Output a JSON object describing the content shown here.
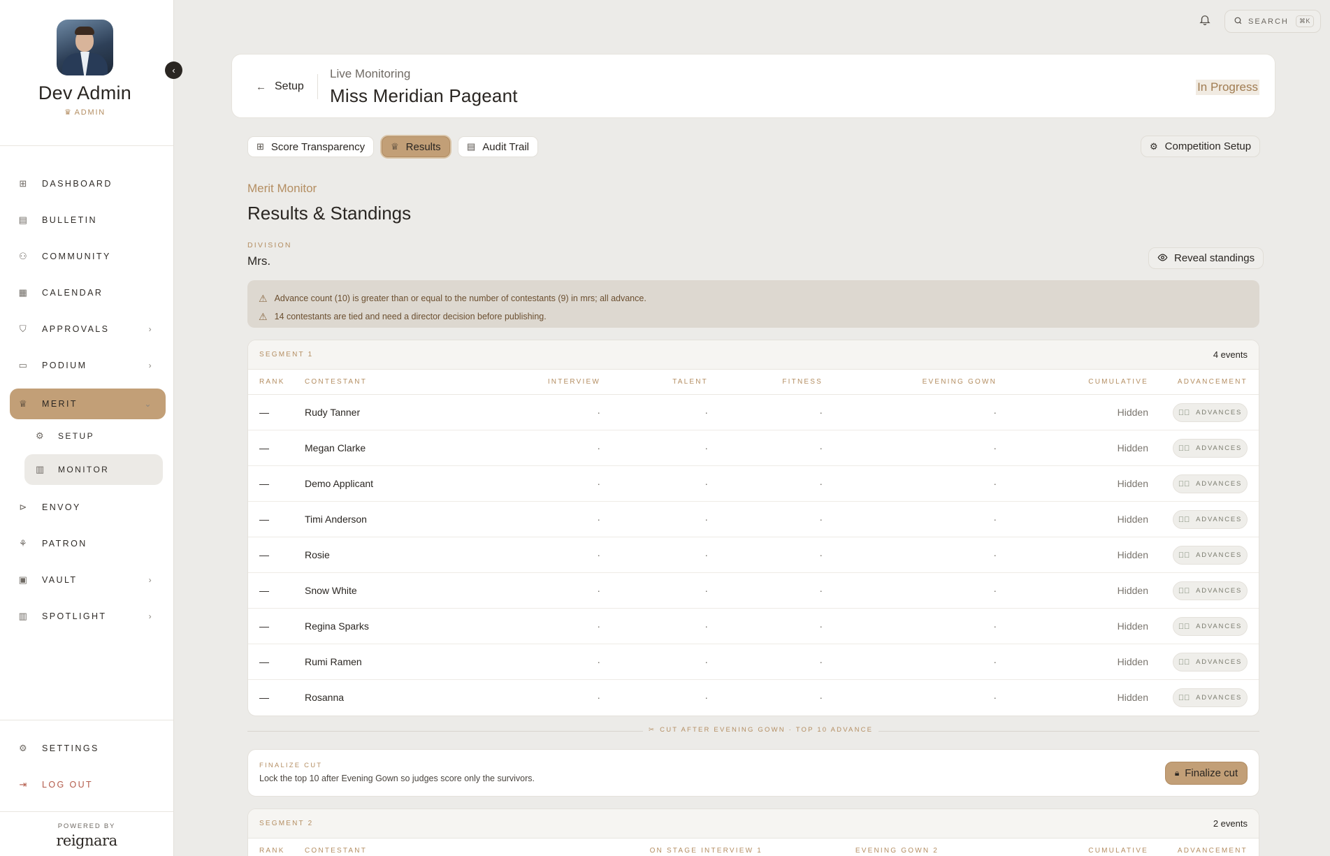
{
  "profile": {
    "name": "Dev Admin",
    "role": "ADMIN"
  },
  "nav": [
    {
      "label": "DASHBOARD",
      "icon": "grid-icon",
      "glyph": "⊞",
      "chevron": false
    },
    {
      "label": "BULLETIN",
      "icon": "newspaper-icon",
      "glyph": "▤",
      "chevron": false
    },
    {
      "label": "COMMUNITY",
      "icon": "users-icon",
      "glyph": "⚇",
      "chevron": false
    },
    {
      "label": "CALENDAR",
      "icon": "calendar-icon",
      "glyph": "▦",
      "chevron": false
    },
    {
      "label": "APPROVALS",
      "icon": "shield-check-icon",
      "glyph": "⛉",
      "chevron": true
    },
    {
      "label": "PODIUM",
      "icon": "message-square-icon",
      "glyph": "▭",
      "chevron": true
    }
  ],
  "merit": {
    "label": "MERIT",
    "sub": [
      {
        "label": "SETUP"
      },
      {
        "label": "MONITOR"
      }
    ]
  },
  "nav2": [
    {
      "label": "ENVOY",
      "icon": "send-icon",
      "glyph": "⊳",
      "chevron": false
    },
    {
      "label": "PATRON",
      "icon": "hand-coins-icon",
      "glyph": "⚘",
      "chevron": false
    },
    {
      "label": "VAULT",
      "icon": "archive-icon",
      "glyph": "▣",
      "chevron": true
    },
    {
      "label": "SPOTLIGHT",
      "icon": "bar-chart-icon",
      "glyph": "▥",
      "chevron": true
    }
  ],
  "bottom_nav": {
    "settings": "SETTINGS",
    "logout": "LOG OUT"
  },
  "powered": {
    "label": "POWERED BY",
    "brand": "reignara"
  },
  "search": {
    "label": "SEARCH",
    "shortcut": "⌘K"
  },
  "header": {
    "back_label": "Setup",
    "subtitle": "Live Monitoring",
    "title": "Miss Meridian Pageant",
    "status": "In Progress"
  },
  "tabs": [
    {
      "label": "Score Transparency",
      "icon": "table-icon",
      "glyph": "⊞"
    },
    {
      "label": "Results",
      "icon": "trophy-icon",
      "glyph": "♕"
    },
    {
      "label": "Audit Trail",
      "icon": "receipt-icon",
      "glyph": "▤"
    }
  ],
  "competition_setup": "Competition Setup",
  "section": {
    "eyebrow": "Merit Monitor",
    "title": "Results & Standings",
    "division_label": "DIVISION",
    "division_value": "Mrs.",
    "reveal": "Reveal standings"
  },
  "alerts": [
    "Advance count (10) is greater than or equal to the number of contestants (9) in mrs; all advance.",
    "14 contestants are tied and need a director decision before publishing."
  ],
  "segment1": {
    "label": "SEGMENT 1",
    "events": "4 events",
    "columns": [
      "RANK",
      "CONTESTANT",
      "INTERVIEW",
      "TALENT",
      "FITNESS",
      "EVENING GOWN",
      "CUMULATIVE",
      "ADVANCEMENT"
    ],
    "rows": [
      {
        "rank": "—",
        "name": "Rudy Tanner",
        "s1": "·",
        "s2": "·",
        "s3": "·",
        "s4": "·",
        "cumulative": "Hidden",
        "advancement": "ADVANCES"
      },
      {
        "rank": "—",
        "name": "Megan Clarke",
        "s1": "·",
        "s2": "·",
        "s3": "·",
        "s4": "·",
        "cumulative": "Hidden",
        "advancement": "ADVANCES"
      },
      {
        "rank": "—",
        "name": "Demo Applicant",
        "s1": "·",
        "s2": "·",
        "s3": "·",
        "s4": "·",
        "cumulative": "Hidden",
        "advancement": "ADVANCES"
      },
      {
        "rank": "—",
        "name": "Timi Anderson",
        "s1": "·",
        "s2": "·",
        "s3": "·",
        "s4": "·",
        "cumulative": "Hidden",
        "advancement": "ADVANCES"
      },
      {
        "rank": "—",
        "name": "Rosie",
        "s1": "·",
        "s2": "·",
        "s3": "·",
        "s4": "·",
        "cumulative": "Hidden",
        "advancement": "ADVANCES"
      },
      {
        "rank": "—",
        "name": "Snow White",
        "s1": "·",
        "s2": "·",
        "s3": "·",
        "s4": "·",
        "cumulative": "Hidden",
        "advancement": "ADVANCES"
      },
      {
        "rank": "—",
        "name": "Regina Sparks",
        "s1": "·",
        "s2": "·",
        "s3": "·",
        "s4": "·",
        "cumulative": "Hidden",
        "advancement": "ADVANCES"
      },
      {
        "rank": "—",
        "name": "Rumi Ramen",
        "s1": "·",
        "s2": "·",
        "s3": "·",
        "s4": "·",
        "cumulative": "Hidden",
        "advancement": "ADVANCES"
      },
      {
        "rank": "—",
        "name": "Rosanna",
        "s1": "·",
        "s2": "·",
        "s3": "·",
        "s4": "·",
        "cumulative": "Hidden",
        "advancement": "ADVANCES"
      }
    ]
  },
  "cut": {
    "label": "CUT AFTER EVENING GOWN · TOP 10 ADVANCE"
  },
  "finalize": {
    "label": "FINALIZE CUT",
    "desc": "Lock the top 10 after Evening Gown so judges score only the survivors.",
    "button": "Finalize cut"
  },
  "segment2": {
    "label": "SEGMENT 2",
    "events": "2 events",
    "columns": [
      "RANK",
      "CONTESTANT",
      "ON STAGE INTERVIEW 1",
      "EVENING GOWN 2",
      "CUMULATIVE",
      "ADVANCEMENT"
    ]
  }
}
